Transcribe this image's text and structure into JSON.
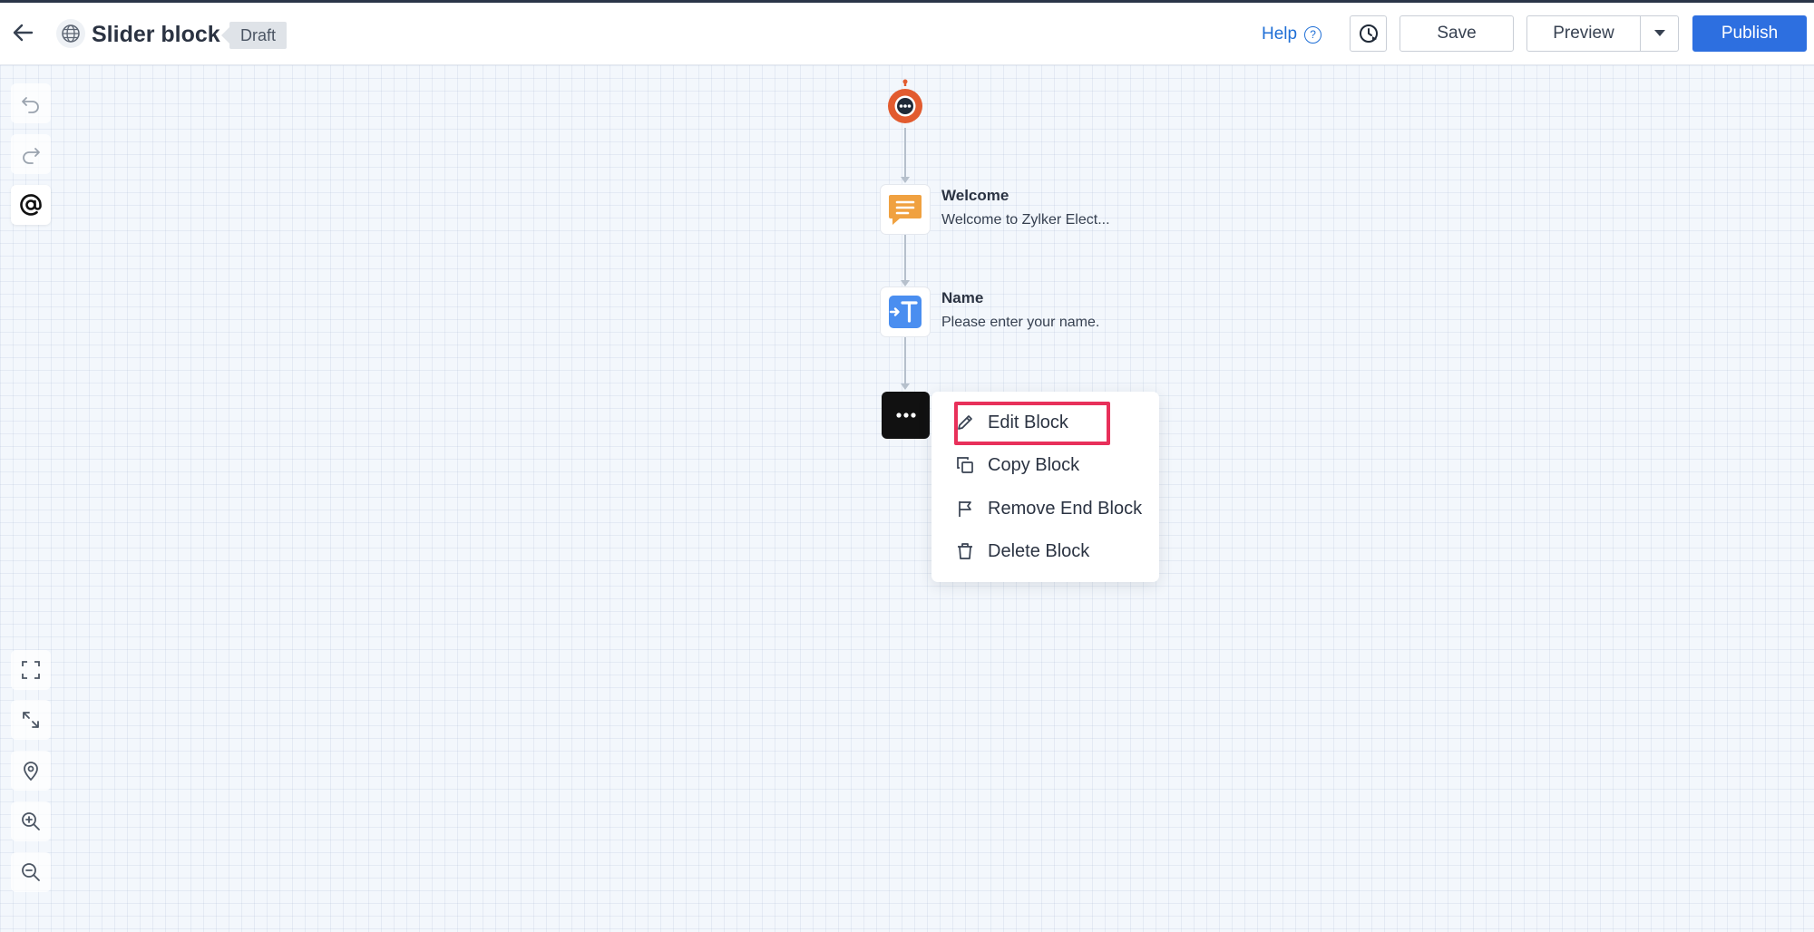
{
  "header": {
    "title": "Slider block",
    "status_badge": "Draft",
    "help_label": "Help",
    "help_glyph": "?",
    "save_label": "Save",
    "preview_label": "Preview",
    "publish_label": "Publish"
  },
  "left_toolbar": {
    "top_tools": [
      "undo-icon",
      "redo-icon",
      "at-sign-icon"
    ],
    "bottom_tools": [
      "fit-to-screen-icon",
      "expand-icon",
      "locate-icon",
      "zoom-in-icon",
      "zoom-out-icon"
    ],
    "active_tool": "at-sign-icon"
  },
  "flow": {
    "nodes": [
      {
        "icon": "chat-message-icon",
        "title": "Welcome",
        "subtitle": "Welcome to Zylker Elect..."
      },
      {
        "icon": "text-input-icon",
        "title": "Name",
        "subtitle": "Please enter your name."
      }
    ]
  },
  "context_menu": {
    "items": [
      {
        "icon": "pencil-icon",
        "label": "Edit Block"
      },
      {
        "icon": "copy-icon",
        "label": "Copy Block"
      },
      {
        "icon": "flag-icon",
        "label": "Remove End Block"
      },
      {
        "icon": "trash-icon",
        "label": "Delete Block"
      }
    ],
    "highlighted_item": "Edit Block"
  },
  "colors": {
    "brand_blue": "#2d6fe0",
    "highlight": "#e8305a",
    "bot_orange": "#e25b2f",
    "welcome_icon": "#f0a140",
    "name_icon": "#4a8ef0"
  }
}
